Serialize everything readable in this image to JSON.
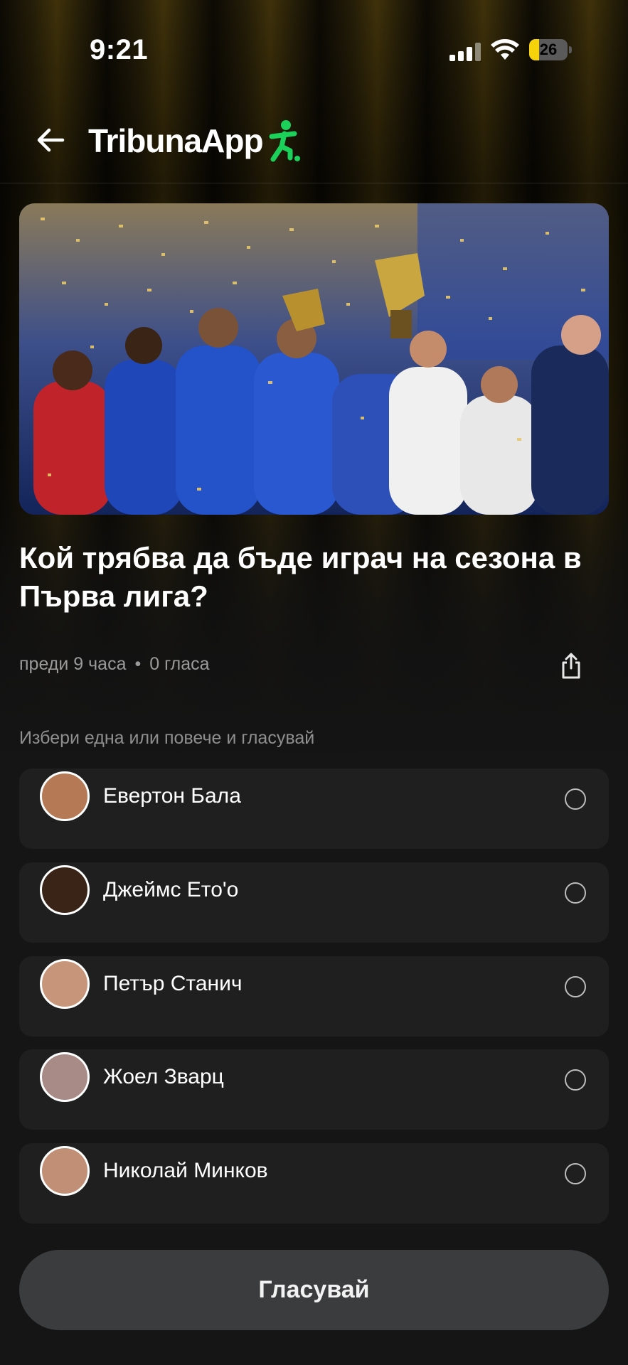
{
  "status_bar": {
    "time": "9:21",
    "battery": "26",
    "battery_level": 0.26,
    "battery_color": "#f5d20a"
  },
  "header": {
    "logo_text": "TribunaApp",
    "back_icon": "arrow-left-icon",
    "logo_icon": "running-person-icon",
    "logo_icon_color": "#1bd15a"
  },
  "article": {
    "title": "Кой трябва да бъде играч на сезона в Първа лига?",
    "time_ago": "преди 9 часа",
    "separator": "•",
    "votes": "0 гласа",
    "share_icon": "share-icon"
  },
  "poll": {
    "instruction": "Избери една или повече и гласувай",
    "options": [
      {
        "label": "Евертон Бала",
        "selected": false
      },
      {
        "label": "Джеймс Ето'о",
        "selected": false
      },
      {
        "label": "Петър Станич",
        "selected": false
      },
      {
        "label": "Жоел Зварц",
        "selected": false
      },
      {
        "label": "Николай Минков",
        "selected": false
      }
    ],
    "vote_button": "Гласувай"
  }
}
